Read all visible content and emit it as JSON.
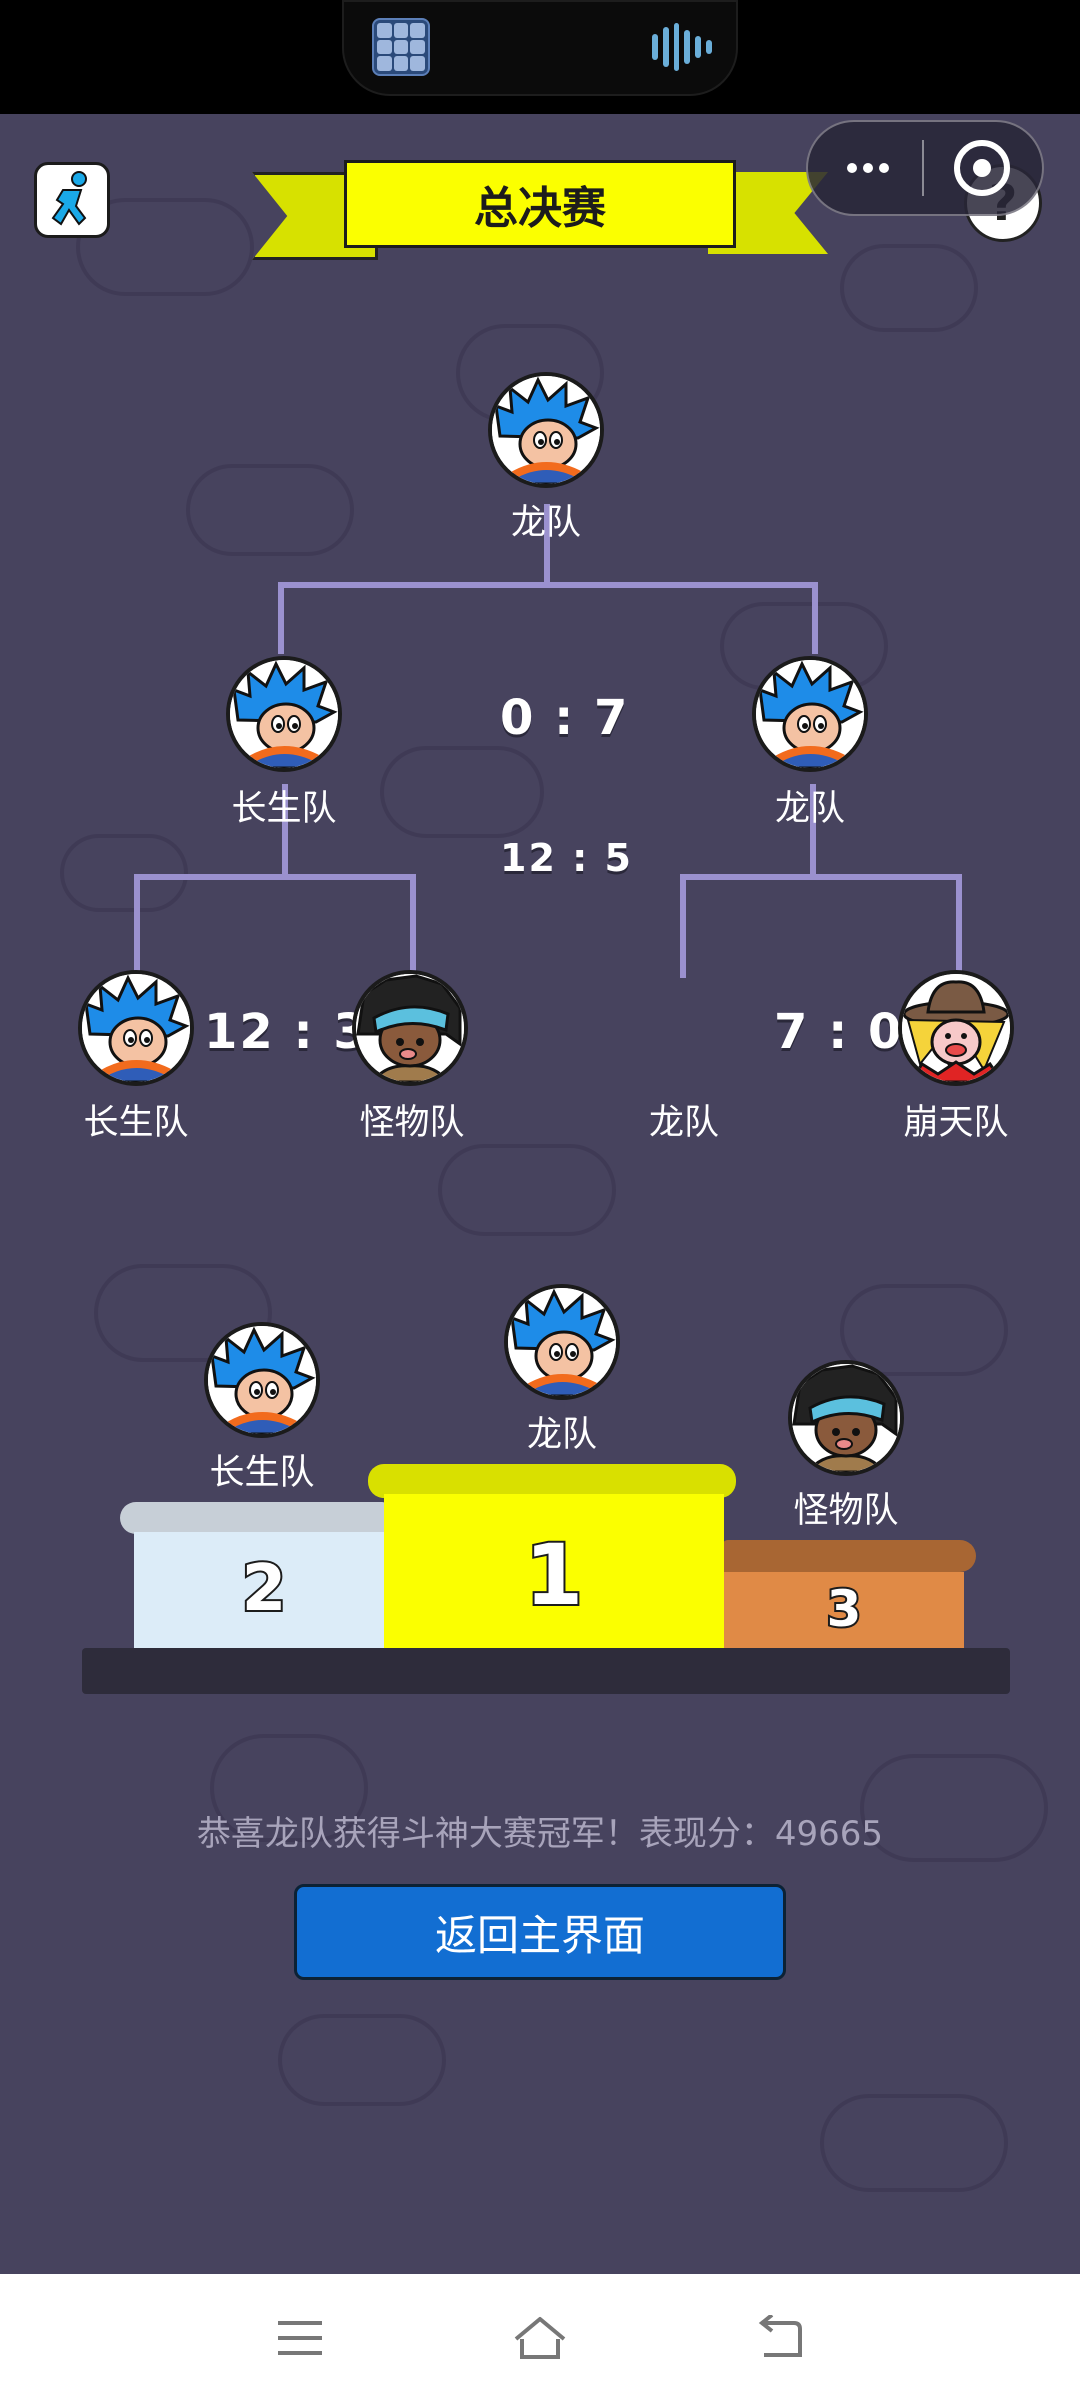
{
  "header": {
    "title": "总决赛",
    "help_symbol": "?"
  },
  "bracket": {
    "champion": {
      "name": "龙队",
      "avatar": "spiky-blue-hair-boy"
    },
    "semifinal_score": "0 : 7",
    "semifinal_score_sub": "12 : 5",
    "semifinal_left": {
      "name": "长生队",
      "avatar": "spiky-blue-hair-boy"
    },
    "semifinal_right": {
      "name": "龙队",
      "avatar": "spiky-blue-hair-boy"
    },
    "quarter_left_score": "12 : 3",
    "quarter_right_score": "7 : 0",
    "quarter_teams": [
      {
        "name": "长生队",
        "avatar": "spiky-blue-hair-boy"
      },
      {
        "name": "怪物队",
        "avatar": "headband-dark-hair-kid"
      },
      {
        "name": "龙队",
        "avatar": ""
      },
      {
        "name": "崩天队",
        "avatar": "cowboy-hat-clown"
      }
    ]
  },
  "podium": {
    "first": {
      "rank": "1",
      "name": "龙队"
    },
    "second": {
      "rank": "2",
      "name": "长生队"
    },
    "third": {
      "rank": "3",
      "name": "怪物队"
    }
  },
  "result": {
    "message": "恭喜龙队获得斗神大赛冠军！表现分：49665",
    "home_button": "返回主界面"
  },
  "colors": {
    "background": "#47435e",
    "bracket_line": "#9b91cf",
    "banner": "#fbff00",
    "button": "#126ed2"
  }
}
